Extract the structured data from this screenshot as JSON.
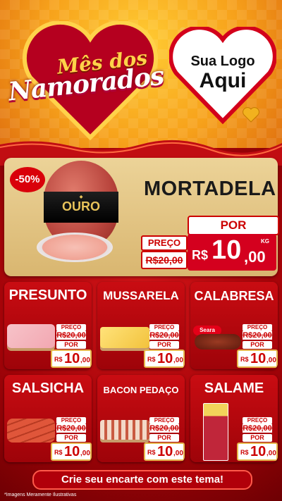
{
  "header": {
    "title_line1": "Mês dos",
    "title_line2": "Namorados",
    "logo_line1": "Sua Logo",
    "logo_line2": "Aqui"
  },
  "featured": {
    "discount": "-50%",
    "name": "MORTADELA",
    "brand": "OURO",
    "preco_label": "PREÇO",
    "old_price": "R$20,00",
    "por_label": "POR",
    "currency": "R$",
    "price_int": "10",
    "price_cents": ",00",
    "unit": "KG"
  },
  "products": [
    {
      "name": "PRESUNTO",
      "preco_label": "PREÇO",
      "old_price": "R$20,00",
      "por_label": "POR",
      "currency": "R$",
      "price_int": "10",
      "price_cents": ",00"
    },
    {
      "name": "MUSSARELA",
      "preco_label": "PREÇO",
      "old_price": "R$20,00",
      "por_label": "POR",
      "currency": "R$",
      "price_int": "10",
      "price_cents": ",00"
    },
    {
      "name": "CALABRESA",
      "preco_label": "PREÇO",
      "old_price": "R$20,00",
      "por_label": "POR",
      "currency": "R$",
      "price_int": "10",
      "price_cents": ",00",
      "brand": "Seara"
    },
    {
      "name": "SALSICHA",
      "preco_label": "PREÇO",
      "old_price": "R$20,00",
      "por_label": "POR",
      "currency": "R$",
      "price_int": "10",
      "price_cents": ",00"
    },
    {
      "name": "BACON PEDAÇO",
      "preco_label": "PREÇO",
      "old_price": "R$20,00",
      "por_label": "POR",
      "currency": "R$",
      "price_int": "10",
      "price_cents": ",00"
    },
    {
      "name": "SALAME",
      "preco_label": "PREÇO",
      "old_price": "R$20,00",
      "por_label": "POR",
      "currency": "R$",
      "price_int": "10",
      "price_cents": ",00"
    }
  ],
  "footer": {
    "cta": "Crie seu encarte com este tema!",
    "disclaimer": "*Imagens Meramente Ilustrativas"
  },
  "colors": {
    "primary_red": "#c90c12",
    "gold": "#ffd24a",
    "orange": "#f7a21b"
  }
}
